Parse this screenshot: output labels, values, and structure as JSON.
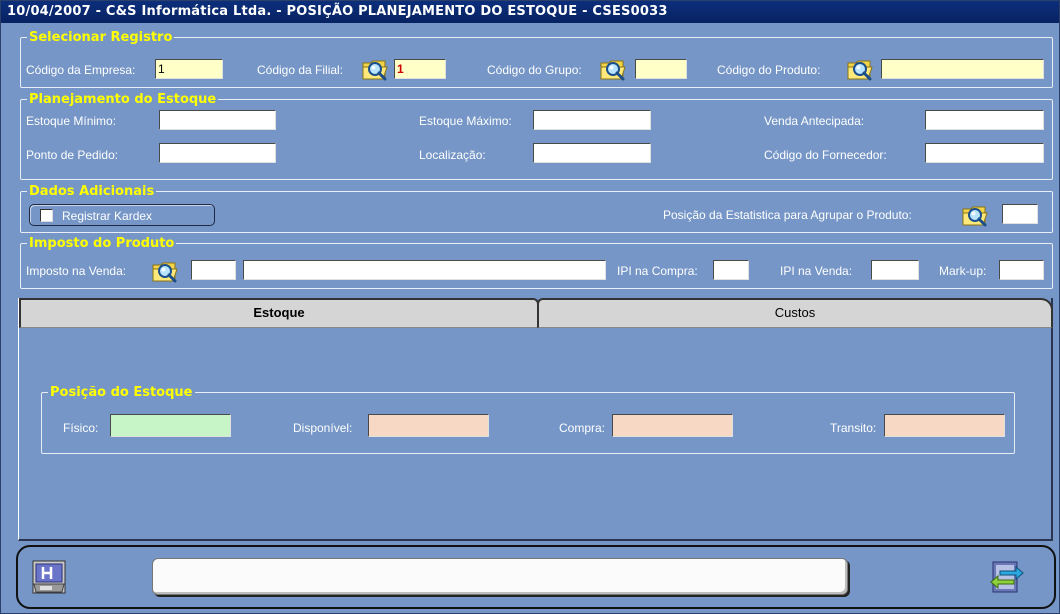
{
  "window": {
    "title": "10/04/2007  -  C&S Informática Ltda.  -  POSIÇÃO PLANEJAMENTO DO ESTOQUE  -  CSES0033"
  },
  "selecionar": {
    "legend": "Selecionar Registro",
    "empresa_label": "Código da Empresa:",
    "empresa_value": "1",
    "filial_label": "Código da Filial:",
    "filial_value": "1",
    "grupo_label": "Código do Grupo:",
    "grupo_value": "",
    "produto_label": "Código do Produto:",
    "produto_value": ""
  },
  "planejamento": {
    "legend": "Planejamento do Estoque",
    "estoque_minimo_label": "Estoque Mínimo:",
    "estoque_minimo_value": "",
    "estoque_maximo_label": "Estoque Máximo:",
    "estoque_maximo_value": "",
    "venda_antecipada_label": "Venda Antecipada:",
    "venda_antecipada_value": "",
    "ponto_pedido_label": "Ponto de Pedido:",
    "ponto_pedido_value": "",
    "localizacao_label": "Localização:",
    "localizacao_value": "",
    "fornecedor_label": "Código do  Fornecedor:",
    "fornecedor_value": ""
  },
  "adicionais": {
    "legend": "Dados Adicionais",
    "kardex_label": "Registrar Kardex",
    "kardex_checked": false,
    "posicao_label": "Posição da Estatistica para Agrupar o Produto:",
    "posicao_value": ""
  },
  "imposto": {
    "legend": "Imposto do Produto",
    "venda_label": "Imposto na Venda:",
    "venda_code": "",
    "venda_desc": "",
    "ipi_compra_label": "IPI na Compra:",
    "ipi_compra_value": "",
    "ipi_venda_label": "IPI na Venda:",
    "ipi_venda_value": "",
    "markup_label": "Mark-up:",
    "markup_value": ""
  },
  "tabs": [
    {
      "label": "Estoque",
      "active": true
    },
    {
      "label": "Custos",
      "active": false
    }
  ],
  "posicao": {
    "legend": "Posição do Estoque",
    "fisico_label": "Físico:",
    "fisico_value": "",
    "disponivel_label": "Disponível:",
    "disponivel_value": "",
    "compra_label": "Compra:",
    "compra_value": "",
    "transito_label": "Transito:",
    "transito_value": ""
  },
  "footer": {
    "status_text": ""
  },
  "icons": {
    "lookup": "folder-search-icon",
    "save": "floppy-disk-icon",
    "exit": "exit-arrows-icon"
  },
  "colors": {
    "background": "#7596c6",
    "titlebar": "#0c2f7c",
    "legend": "#ffff00",
    "field_yellow": "#ffffc8",
    "field_green": "#c8f5c8",
    "field_peach": "#f7d8c4"
  }
}
